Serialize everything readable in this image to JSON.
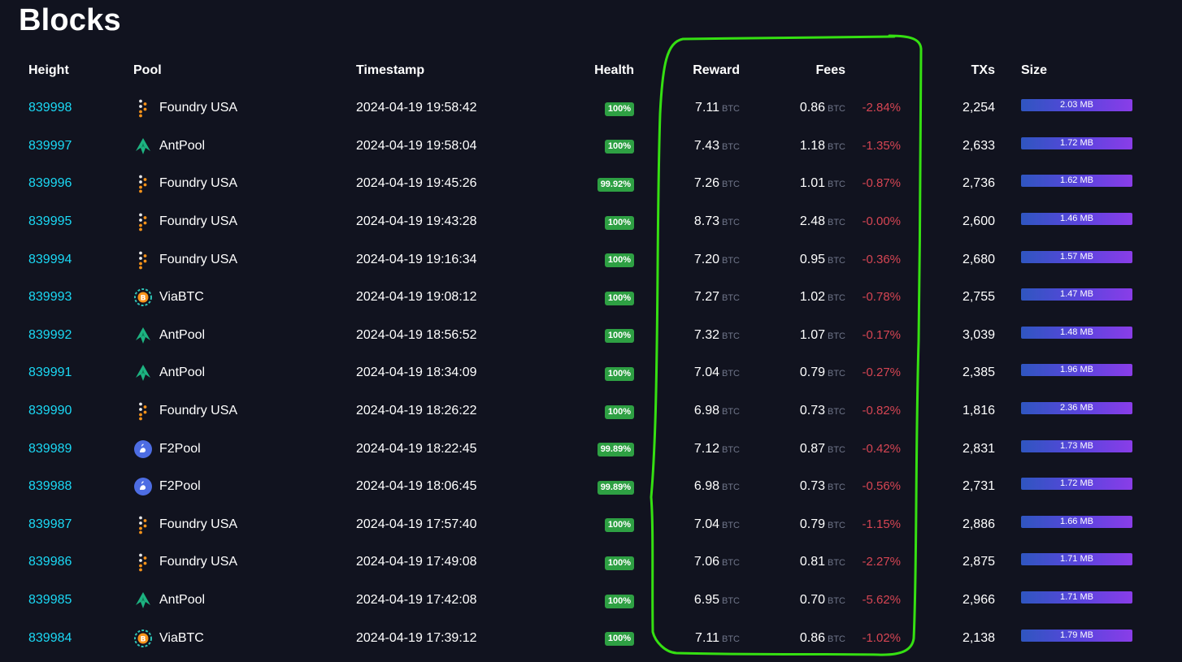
{
  "page": {
    "title": "Blocks"
  },
  "columns": {
    "height": "Height",
    "pool": "Pool",
    "timestamp": "Timestamp",
    "health": "Health",
    "reward": "Reward",
    "fees": "Fees",
    "txs": "TXs",
    "size": "Size"
  },
  "unit": "BTC",
  "colors": {
    "background": "#11131f",
    "link": "#1bd8f4",
    "health_badge": "#2ea043",
    "negative": "#d64553",
    "highlight_outline": "#35e012"
  },
  "blocks": [
    {
      "height": "839998",
      "pool": "Foundry USA",
      "pool_icon": "foundry-icon",
      "timestamp": "2024-04-19 19:58:42",
      "health": "100%",
      "reward": "7.11",
      "fees": "0.86",
      "delta": "-2.84%",
      "txs": "2,254",
      "size": "2.03 MB",
      "size_fill": 1.0
    },
    {
      "height": "839997",
      "pool": "AntPool",
      "pool_icon": "antpool-icon",
      "timestamp": "2024-04-19 19:58:04",
      "health": "100%",
      "reward": "7.43",
      "fees": "1.18",
      "delta": "-1.35%",
      "txs": "2,633",
      "size": "1.72 MB",
      "size_fill": 1.0
    },
    {
      "height": "839996",
      "pool": "Foundry USA",
      "pool_icon": "foundry-icon",
      "timestamp": "2024-04-19 19:45:26",
      "health": "99.92%",
      "reward": "7.26",
      "fees": "1.01",
      "delta": "-0.87%",
      "txs": "2,736",
      "size": "1.62 MB",
      "size_fill": 1.0
    },
    {
      "height": "839995",
      "pool": "Foundry USA",
      "pool_icon": "foundry-icon",
      "timestamp": "2024-04-19 19:43:28",
      "health": "100%",
      "reward": "8.73",
      "fees": "2.48",
      "delta": "-0.00%",
      "txs": "2,600",
      "size": "1.46 MB",
      "size_fill": 1.0
    },
    {
      "height": "839994",
      "pool": "Foundry USA",
      "pool_icon": "foundry-icon",
      "timestamp": "2024-04-19 19:16:34",
      "health": "100%",
      "reward": "7.20",
      "fees": "0.95",
      "delta": "-0.36%",
      "txs": "2,680",
      "size": "1.57 MB",
      "size_fill": 1.0
    },
    {
      "height": "839993",
      "pool": "ViaBTC",
      "pool_icon": "viabtc-icon",
      "timestamp": "2024-04-19 19:08:12",
      "health": "100%",
      "reward": "7.27",
      "fees": "1.02",
      "delta": "-0.78%",
      "txs": "2,755",
      "size": "1.47 MB",
      "size_fill": 1.0
    },
    {
      "height": "839992",
      "pool": "AntPool",
      "pool_icon": "antpool-icon",
      "timestamp": "2024-04-19 18:56:52",
      "health": "100%",
      "reward": "7.32",
      "fees": "1.07",
      "delta": "-0.17%",
      "txs": "3,039",
      "size": "1.48 MB",
      "size_fill": 1.0
    },
    {
      "height": "839991",
      "pool": "AntPool",
      "pool_icon": "antpool-icon",
      "timestamp": "2024-04-19 18:34:09",
      "health": "100%",
      "reward": "7.04",
      "fees": "0.79",
      "delta": "-0.27%",
      "txs": "2,385",
      "size": "1.96 MB",
      "size_fill": 1.0
    },
    {
      "height": "839990",
      "pool": "Foundry USA",
      "pool_icon": "foundry-icon",
      "timestamp": "2024-04-19 18:26:22",
      "health": "100%",
      "reward": "6.98",
      "fees": "0.73",
      "delta": "-0.82%",
      "txs": "1,816",
      "size": "2.36 MB",
      "size_fill": 1.0
    },
    {
      "height": "839989",
      "pool": "F2Pool",
      "pool_icon": "f2pool-icon",
      "timestamp": "2024-04-19 18:22:45",
      "health": "99.89%",
      "reward": "7.12",
      "fees": "0.87",
      "delta": "-0.42%",
      "txs": "2,831",
      "size": "1.73 MB",
      "size_fill": 1.0
    },
    {
      "height": "839988",
      "pool": "F2Pool",
      "pool_icon": "f2pool-icon",
      "timestamp": "2024-04-19 18:06:45",
      "health": "99.89%",
      "reward": "6.98",
      "fees": "0.73",
      "delta": "-0.56%",
      "txs": "2,731",
      "size": "1.72 MB",
      "size_fill": 1.0
    },
    {
      "height": "839987",
      "pool": "Foundry USA",
      "pool_icon": "foundry-icon",
      "timestamp": "2024-04-19 17:57:40",
      "health": "100%",
      "reward": "7.04",
      "fees": "0.79",
      "delta": "-1.15%",
      "txs": "2,886",
      "size": "1.66 MB",
      "size_fill": 1.0
    },
    {
      "height": "839986",
      "pool": "Foundry USA",
      "pool_icon": "foundry-icon",
      "timestamp": "2024-04-19 17:49:08",
      "health": "100%",
      "reward": "7.06",
      "fees": "0.81",
      "delta": "-2.27%",
      "txs": "2,875",
      "size": "1.71 MB",
      "size_fill": 1.0
    },
    {
      "height": "839985",
      "pool": "AntPool",
      "pool_icon": "antpool-icon",
      "timestamp": "2024-04-19 17:42:08",
      "health": "100%",
      "reward": "6.95",
      "fees": "0.70",
      "delta": "-5.62%",
      "txs": "2,966",
      "size": "1.71 MB",
      "size_fill": 1.0
    },
    {
      "height": "839984",
      "pool": "ViaBTC",
      "pool_icon": "viabtc-icon",
      "timestamp": "2024-04-19 17:39:12",
      "health": "100%",
      "reward": "7.11",
      "fees": "0.86",
      "delta": "-1.02%",
      "txs": "2,138",
      "size": "1.79 MB",
      "size_fill": 1.0
    }
  ]
}
